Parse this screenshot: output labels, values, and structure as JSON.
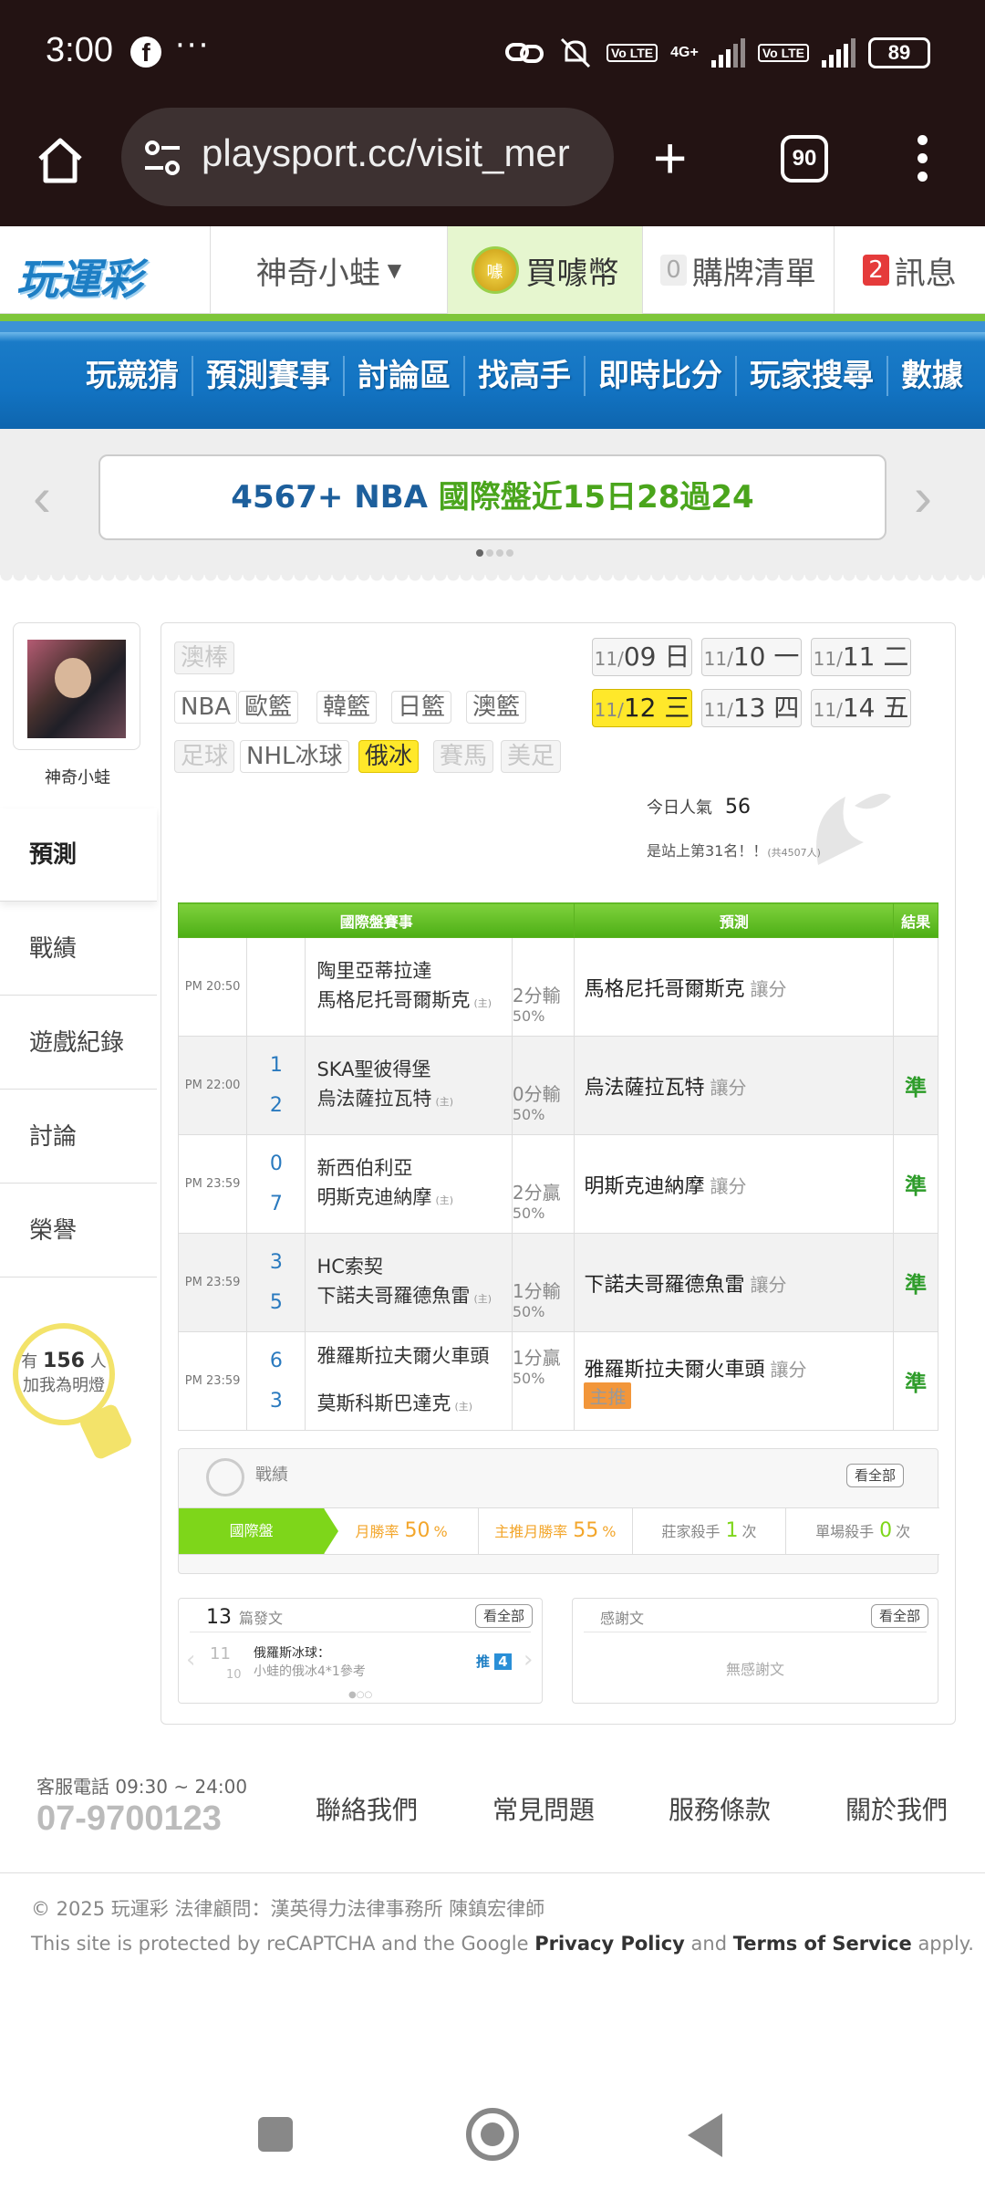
{
  "status": {
    "time": "3:00",
    "more": "···",
    "fb": "f",
    "lte1": "Vo LTE",
    "net": "4G+",
    "lte2": "Vo LTE",
    "battery": "89"
  },
  "browser": {
    "url": "playsport.cc/visit_mer",
    "tab_count": "90"
  },
  "header": {
    "logo": "玩運彩",
    "user": "神奇小蛙",
    "coin_label": "買噱幣",
    "coin_icon": "噱",
    "cart_count": "0",
    "cart_label": "購牌清單",
    "msg_count": "2",
    "msg_label": "訊息"
  },
  "nav": [
    "玩競猜",
    "預測賽事",
    "討論區",
    "找高手",
    "即時比分",
    "玩家搜尋",
    "數據"
  ],
  "banner": {
    "prefix": "4567+ NBA",
    "text": "國際盤近15日28過24"
  },
  "profile": {
    "name": "神奇小蛙"
  },
  "sidebar": [
    "預測",
    "戰績",
    "遊戲紀錄",
    "討論",
    "榮譽"
  ],
  "fans": {
    "pre": "有",
    "count": "156",
    "unit": "人",
    "text": "加我為明燈"
  },
  "sports": {
    "row1": [
      {
        "label": "澳棒",
        "state": "dis"
      }
    ],
    "row2": [
      {
        "label": "NBA",
        "state": ""
      },
      {
        "label": "歐籃",
        "state": ""
      },
      {
        "label": "韓籃",
        "state": ""
      },
      {
        "label": "日籃",
        "state": ""
      },
      {
        "label": "澳籃",
        "state": ""
      }
    ],
    "row3": [
      {
        "label": "足球",
        "state": "dis"
      },
      {
        "label": "NHL冰球",
        "state": ""
      },
      {
        "label": "俄冰",
        "state": "sel"
      },
      {
        "label": "賽馬",
        "state": "dis"
      },
      {
        "label": "美足",
        "state": "dis"
      }
    ]
  },
  "dates": [
    {
      "m": "11/",
      "d": "09 日"
    },
    {
      "m": "11/",
      "d": "10 一"
    },
    {
      "m": "11/",
      "d": "11 二"
    },
    {
      "m": "11/",
      "d": "12 三"
    },
    {
      "m": "11/",
      "d": "13 四"
    },
    {
      "m": "11/",
      "d": "14 五"
    }
  ],
  "popularity": {
    "label": "今日人氣",
    "value": "56",
    "rank": "是站上第31名！！",
    "total": "(共4507人)"
  },
  "table": {
    "headers": [
      "國際盤賽事",
      "預測",
      "結果"
    ],
    "rows": [
      {
        "time": "PM 20:50",
        "s1": "",
        "s2": "",
        "t1": "陶里亞蒂拉達",
        "t2": "馬格尼托哥爾斯克",
        "home": "(主)",
        "l1": "2分輸",
        "l2": "50%",
        "pick": "馬格尼托哥爾斯克",
        "kind": "讓分",
        "result": "",
        "star": ""
      },
      {
        "time": "PM 22:00",
        "s1": "1",
        "s2": "2",
        "t1": "SKA聖彼得堡",
        "t2": "烏法薩拉瓦特",
        "home": "(主)",
        "l1": "0分輸",
        "l2": "50%",
        "pick": "烏法薩拉瓦特",
        "kind": "讓分",
        "result": "準",
        "star": ""
      },
      {
        "time": "PM 23:59",
        "s1": "0",
        "s2": "7",
        "t1": "新西伯利亞",
        "t2": "明斯克迪納摩",
        "home": "(主)",
        "l1": "2分贏",
        "l2": "50%",
        "pick": "明斯克迪納摩",
        "kind": "讓分",
        "result": "準",
        "star": ""
      },
      {
        "time": "PM 23:59",
        "s1": "3",
        "s2": "5",
        "t1": "HC索契",
        "t2": "下諾夫哥羅德魚雷",
        "home": "(主)",
        "l1": "1分輸",
        "l2": "50%",
        "pick": "下諾夫哥羅德魚雷",
        "kind": "讓分",
        "result": "準",
        "star": ""
      },
      {
        "time": "PM 23:59",
        "s1": "6",
        "s2": "3",
        "t1": "雅羅斯拉夫爾火車頭",
        "t2": "莫斯科斯巴達克",
        "home": "(主)",
        "l1": "1分贏",
        "l2": "50%",
        "pick": "雅羅斯拉夫爾火車頭",
        "kind": "讓分",
        "result": "準",
        "star": "主推"
      }
    ]
  },
  "record": {
    "title": "戰績",
    "see_all": "看全部",
    "items": [
      {
        "label": "國際盤",
        "value": "",
        "unit": ""
      },
      {
        "label": "月勝率",
        "value": "50",
        "unit": "%"
      },
      {
        "label": "主推月勝率",
        "value": "55",
        "unit": "%"
      },
      {
        "label": "莊家殺手",
        "value": "1",
        "unit": "次"
      },
      {
        "label": "單場殺手",
        "value": "0",
        "unit": "次"
      }
    ]
  },
  "posts": {
    "count": "13",
    "label": "篇發文",
    "see_all": "看全部",
    "month": "11",
    "day": "10",
    "title": "俄羅斯冰球：",
    "sub": "小蛙的俄冰4*1參考",
    "push": "推",
    "push_count": "4"
  },
  "thanks": {
    "label": "感謝文",
    "see_all": "看全部",
    "empty": "無感謝文"
  },
  "footer": {
    "hours": "客服電話 09:30 ~ 24:00",
    "phone": "07-9700123",
    "links": [
      "聯絡我們",
      "常見問題",
      "服務條款",
      "關於我們"
    ],
    "copyright": "© 2025 玩運彩 法律顧問：漢英得力法律事務所 陳鎮宏律師",
    "recaptcha_pre": "This site is protected by reCAPTCHA and the Google",
    "privacy": "Privacy Policy",
    "and": "and",
    "terms": "Terms of Service",
    "apply": "apply."
  },
  "colors": {
    "nav": "#1273c2",
    "green": "#4cae15",
    "yellow": "#ffe82a"
  }
}
